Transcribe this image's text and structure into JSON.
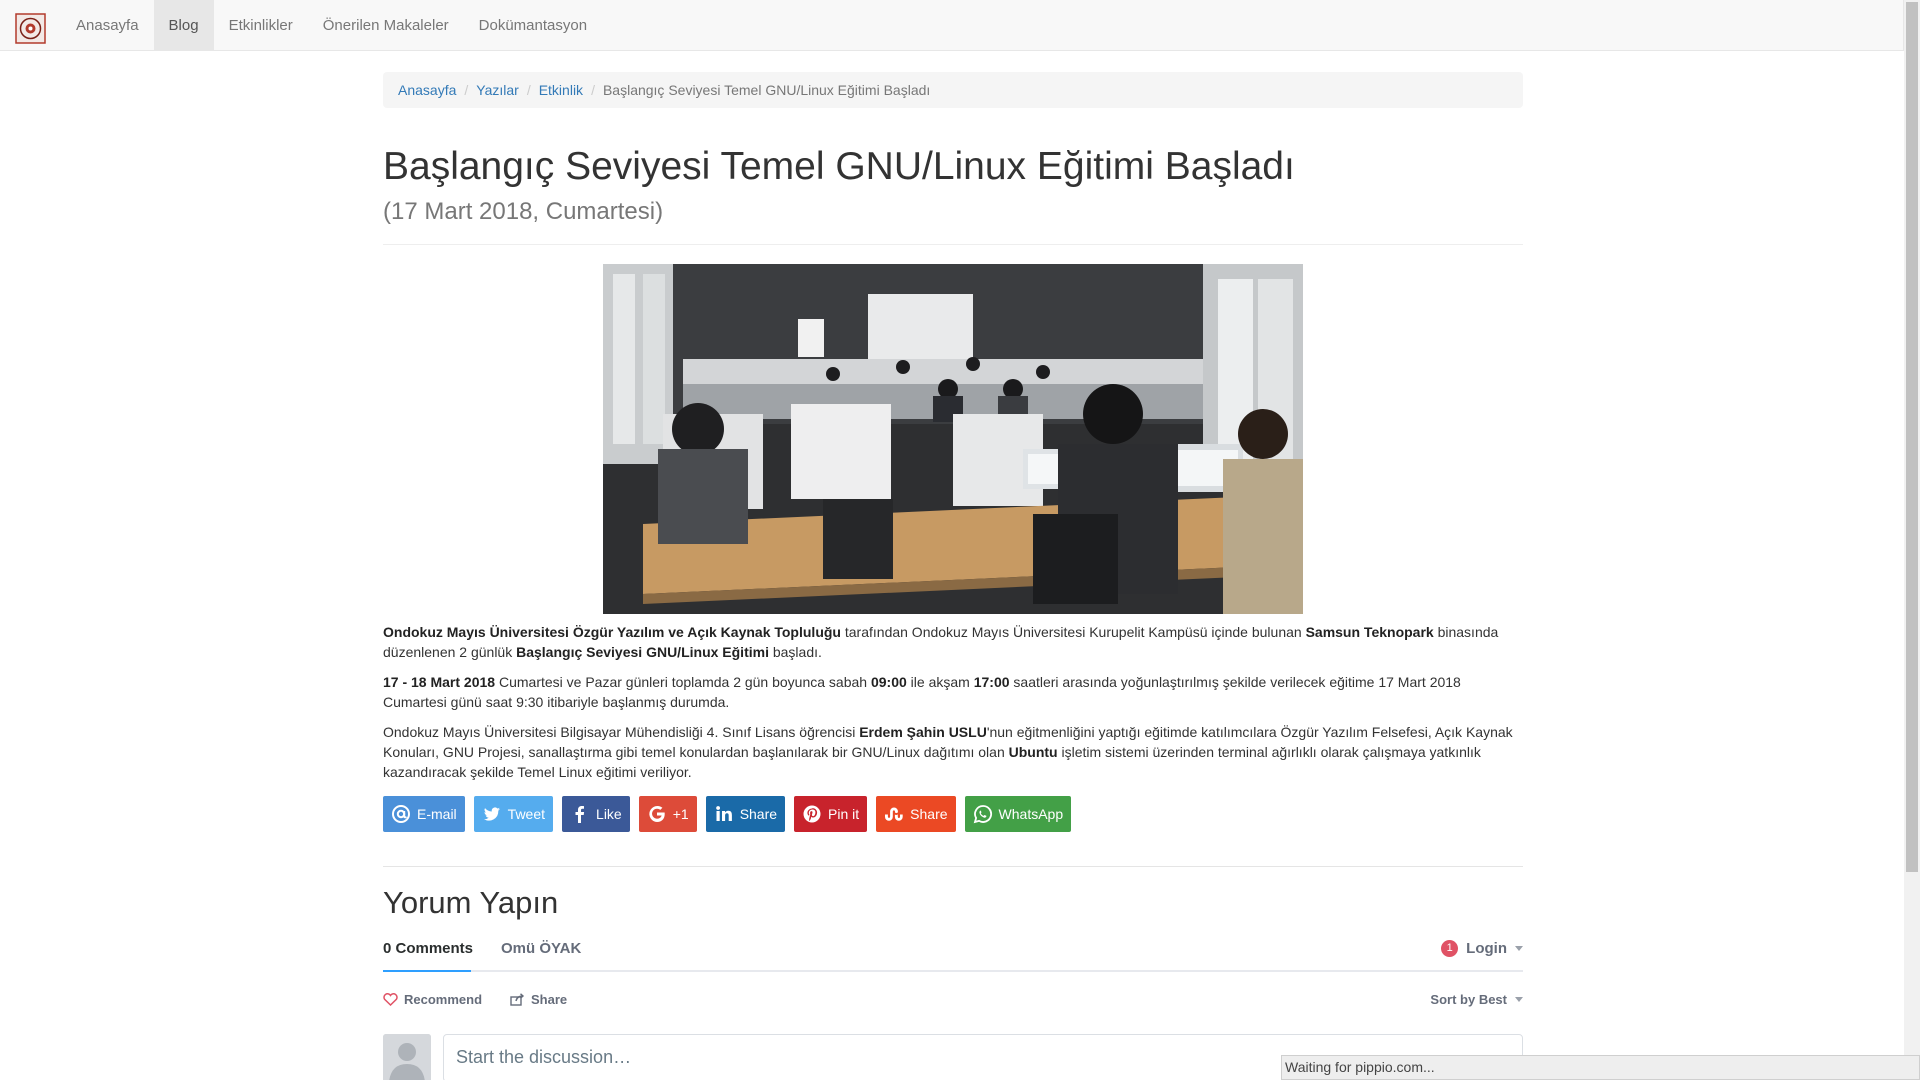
{
  "navbar": {
    "items": [
      {
        "label": "Anasayfa",
        "active": false
      },
      {
        "label": "Blog",
        "active": true
      },
      {
        "label": "Etkinlikler",
        "active": false
      },
      {
        "label": "Önerilen Makaleler",
        "active": false
      },
      {
        "label": "Dokümantasyon",
        "active": false
      }
    ]
  },
  "breadcrumb": {
    "links": [
      "Anasayfa",
      "Yazılar",
      "Etkinlik"
    ],
    "current": "Başlangıç Seviyesi Temel GNU/Linux Eğitimi Başladı"
  },
  "post": {
    "title": "Başlangıç Seviyesi Temel GNU/Linux Eğitimi Başladı",
    "date": "(17 Mart 2018, Cumartesi)",
    "p1": {
      "b1": "Ondokuz Mayıs Üniversitesi Özgür Yazılım ve Açık Kaynak Topluluğu",
      "t1": " tarafından Ondokuz Mayıs Üniversitesi Kurupelit Kampüsü içinde bulunan ",
      "b2": "Samsun Teknopark",
      "t2": " binasında düzenlenen 2 günlük ",
      "b3": "Başlangıç Seviyesi GNU/Linux Eğitimi",
      "t3": " başladı."
    },
    "p2": {
      "b1": "17 - 18 Mart 2018",
      "t1": " Cumartesi ve Pazar günleri toplamda 2 gün boyunca sabah ",
      "b2": "09:00",
      "t2": " ile akşam ",
      "b3": "17:00",
      "t3": " saatleri arasında yoğunlaştırılmış şekilde verilecek eğitime 17 Mart 2018 Cumartesi günü saat 9:30 itibariyle başlanmış durumda."
    },
    "p3": {
      "t1": "Ondokuz Mayıs Üniversitesi Bilgisayar Mühendisliği 4. Sınıf Lisans öğrencisi ",
      "b1": "Erdem Şahin USLU",
      "t2": "'nun eğitmenliğini yaptığı eğitimde katılımcılara Özgür Yazılım Felsefesi, Açık Kaynak Konuları, GNU Projesi, sanallaştırma gibi temel konulardan başlanılarak bir GNU/Linux dağıtımı olan ",
      "b2": "Ubuntu",
      "t3": " işletim sistemi üzerinden terminal ağırlıklı olarak çalışmaya yatkınlık kazandıracak şekilde Temel Linux eğitimi veriliyor."
    }
  },
  "share": {
    "email": "E-mail",
    "tweet": "Tweet",
    "like": "Like",
    "gplus": "+1",
    "linkedin": "Share",
    "pinterest": "Pin it",
    "stumble": "Share",
    "whatsapp": "WhatsApp",
    "colors": {
      "email": "#4a90d9",
      "tweet": "#55acee",
      "like": "#3b5998",
      "gplus": "#dd4b39",
      "linkedin": "#1a6aa8",
      "pinterest": "#c8232c",
      "stumble": "#eb4924",
      "whatsapp": "#43a047"
    }
  },
  "comments": {
    "title": "Yorum Yapın",
    "tab_comments": "0 Comments",
    "tab_community": "Omü ÖYAK",
    "login_badge": "1",
    "login": "Login",
    "recommend": "Recommend",
    "share": "Share",
    "sort": "Sort by Best",
    "placeholder": "Start the discussion…"
  },
  "status": "Waiting for pippio.com..."
}
